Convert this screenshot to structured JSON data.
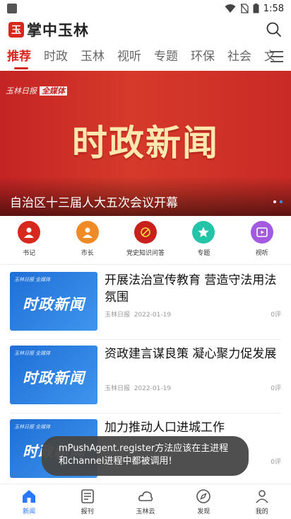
{
  "status": {
    "time": "1:58"
  },
  "app": {
    "name": "掌中玉林",
    "logo_char": "玉"
  },
  "tabs": [
    {
      "label": "推荐",
      "active": true
    },
    {
      "label": "时政"
    },
    {
      "label": "玉林"
    },
    {
      "label": "视听"
    },
    {
      "label": "专题"
    },
    {
      "label": "环保"
    },
    {
      "label": "社会"
    },
    {
      "label": "文"
    }
  ],
  "banner": {
    "title": "时政新闻",
    "brand": "玉林日报",
    "badge": "全媒体",
    "caption": "自治区十三届人大五次会议开幕"
  },
  "quick_links": [
    {
      "label": "书记",
      "color": "#d8281e",
      "icon": "person-icon"
    },
    {
      "label": "市长",
      "color": "#f08a24",
      "icon": "person-icon"
    },
    {
      "label": "党史知识问答",
      "color": "#c8201a",
      "icon": "party-emblem-icon"
    },
    {
      "label": "专题",
      "color": "#25c4a8",
      "icon": "star-icon"
    },
    {
      "label": "视听",
      "color": "#a45ae0",
      "icon": "video-icon"
    }
  ],
  "news": [
    {
      "title": "开展法治宣传教育 营造守法用法氛围",
      "source": "玉林日报",
      "date": "2022-01-19",
      "comments": "0评",
      "thumb_title": "时政新闻",
      "thumb_brand": "玉林日报",
      "thumb_badge": "全媒体"
    },
    {
      "title": "资政建言谋良策 凝心聚力促发展",
      "source": "玉林日报",
      "date": "2022-01-19",
      "comments": "0评",
      "thumb_title": "时政新闻",
      "thumb_brand": "玉林日报",
      "thumb_badge": "全媒体"
    },
    {
      "title": "加力推动人口进城工作",
      "source": "",
      "date": "",
      "comments": "0评",
      "thumb_title": "时政新闻",
      "thumb_brand": "玉林日报",
      "thumb_badge": "全媒体"
    }
  ],
  "toast": {
    "line1": "mPushAgent.register方法应该在主进程",
    "line2": "和channel进程中都被调用!"
  },
  "bottom_nav": [
    {
      "label": "新闻",
      "active": true,
      "icon": "home-icon"
    },
    {
      "label": "报刊",
      "icon": "newspaper-icon"
    },
    {
      "label": "玉林云",
      "icon": "cloud-icon"
    },
    {
      "label": "发现",
      "icon": "compass-icon"
    },
    {
      "label": "我的",
      "icon": "user-icon"
    }
  ],
  "colors": {
    "accent": "#d8281e",
    "nav_active": "#2979ff"
  }
}
